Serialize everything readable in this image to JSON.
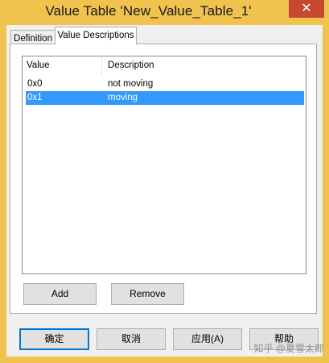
{
  "window": {
    "title": "Value Table 'New_Value_Table_1'",
    "close_glyph": "✕"
  },
  "tabs": [
    {
      "label": "Definition",
      "active": false
    },
    {
      "label": "Value Descriptions",
      "active": true
    }
  ],
  "list": {
    "columns": [
      "Value",
      "Description"
    ],
    "rows": [
      {
        "value": "0x0",
        "description": "not moving",
        "selected": false
      },
      {
        "value": "0x1",
        "description": "moving",
        "selected": true
      }
    ]
  },
  "panel_buttons": {
    "add": "Add",
    "remove": "Remove"
  },
  "dialog_buttons": {
    "ok": "确定",
    "cancel": "取消",
    "apply": "应用(A)",
    "help": "帮助"
  },
  "watermark": "知乎 @夏雪太郎",
  "colors": {
    "title_bar": "#f0c24e",
    "close_button": "#c7482f",
    "selection": "#3399ff",
    "dialog_bg": "#f0f0f0"
  }
}
